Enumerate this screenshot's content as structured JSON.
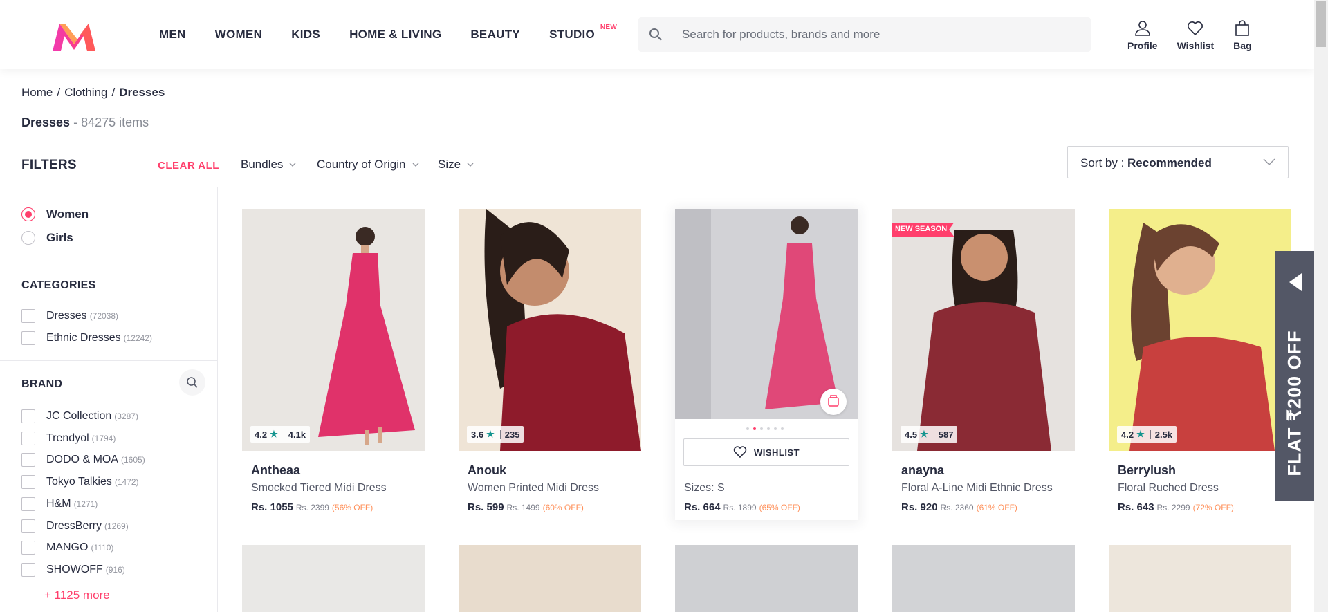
{
  "header": {
    "nav": [
      "MEN",
      "WOMEN",
      "KIDS",
      "HOME & LIVING",
      "BEAUTY",
      "STUDIO"
    ],
    "studio_badge": "NEW",
    "search_placeholder": "Search for products, brands and more",
    "actions": {
      "profile": "Profile",
      "wishlist": "Wishlist",
      "bag": "Bag"
    },
    "accent": "#ff3f6c"
  },
  "breadcrumb": {
    "home": "Home",
    "clothing": "Clothing",
    "current": "Dresses"
  },
  "title": {
    "name": "Dresses",
    "count": "- 84275 items"
  },
  "filterbar": {
    "filters_label": "FILTERS",
    "clear_all": "CLEAR ALL",
    "chips": [
      "Bundles",
      "Country of Origin",
      "Size"
    ],
    "sort_prefix": "Sort by : ",
    "sort_value": "Recommended"
  },
  "sidebar": {
    "gender": [
      {
        "label": "Women",
        "selected": true
      },
      {
        "label": "Girls",
        "selected": false
      }
    ],
    "categories_title": "CATEGORIES",
    "categories": [
      {
        "label": "Dresses",
        "count": "(72038)"
      },
      {
        "label": "Ethnic Dresses",
        "count": "(12242)"
      }
    ],
    "brand_title": "BRAND",
    "brands": [
      {
        "label": "JC Collection",
        "count": "(3287)"
      },
      {
        "label": "Trendyol",
        "count": "(1794)"
      },
      {
        "label": "DODO & MOA",
        "count": "(1605)"
      },
      {
        "label": "Tokyo Talkies",
        "count": "(1472)"
      },
      {
        "label": "H&M",
        "count": "(1271)"
      },
      {
        "label": "DressBerry",
        "count": "(1269)"
      },
      {
        "label": "MANGO",
        "count": "(1110)"
      },
      {
        "label": "SHOWOFF",
        "count": "(916)"
      }
    ],
    "more": "+ 1125 more"
  },
  "products": [
    {
      "brand": "Antheaa",
      "name": "Smocked Tiered Midi Dress",
      "price": "Rs. 1055",
      "mrp": "Rs. 2399",
      "off": "(56% OFF)",
      "rating": "4.2",
      "reviews": "4.1k",
      "bg": "#e9e6e2",
      "dress": "#e0326a"
    },
    {
      "brand": "Anouk",
      "name": "Women Printed Midi Dress",
      "price": "Rs. 599",
      "mrp": "Rs. 1499",
      "off": "(60% OFF)",
      "rating": "3.6",
      "reviews": "235",
      "bg": "#efe4d6",
      "dress": "#8e1b2b"
    },
    {
      "sizes": "Sizes: S",
      "wishlist": "WISHLIST",
      "price": "Rs. 664",
      "mrp": "Rs. 1899",
      "off": "(65% OFF)",
      "bg": "#d2d2d6",
      "dress": "#e04878"
    },
    {
      "brand": "anayna",
      "name": "Floral A-Line Midi Ethnic Dress",
      "price": "Rs. 920",
      "mrp": "Rs. 2360",
      "off": "(61% OFF)",
      "rating": "4.5",
      "reviews": "587",
      "badge": "NEW SEASON",
      "bg": "#e6e2df",
      "dress": "#8a2a34"
    },
    {
      "brand": "Berrylush",
      "name": "Floral Ruched Dress",
      "price": "Rs. 643",
      "mrp": "Rs. 2299",
      "off": "(72% OFF)",
      "rating": "4.2",
      "reviews": "2.5k",
      "bg": "#f4ee8a",
      "dress": "#c8403e"
    }
  ],
  "promo": "FLAT ₹200 OFF",
  "row2_colors": [
    "#e9e8e6",
    "#e8dccd",
    "#cfd0d3",
    "#d2d3d6",
    "#ede6dc"
  ]
}
